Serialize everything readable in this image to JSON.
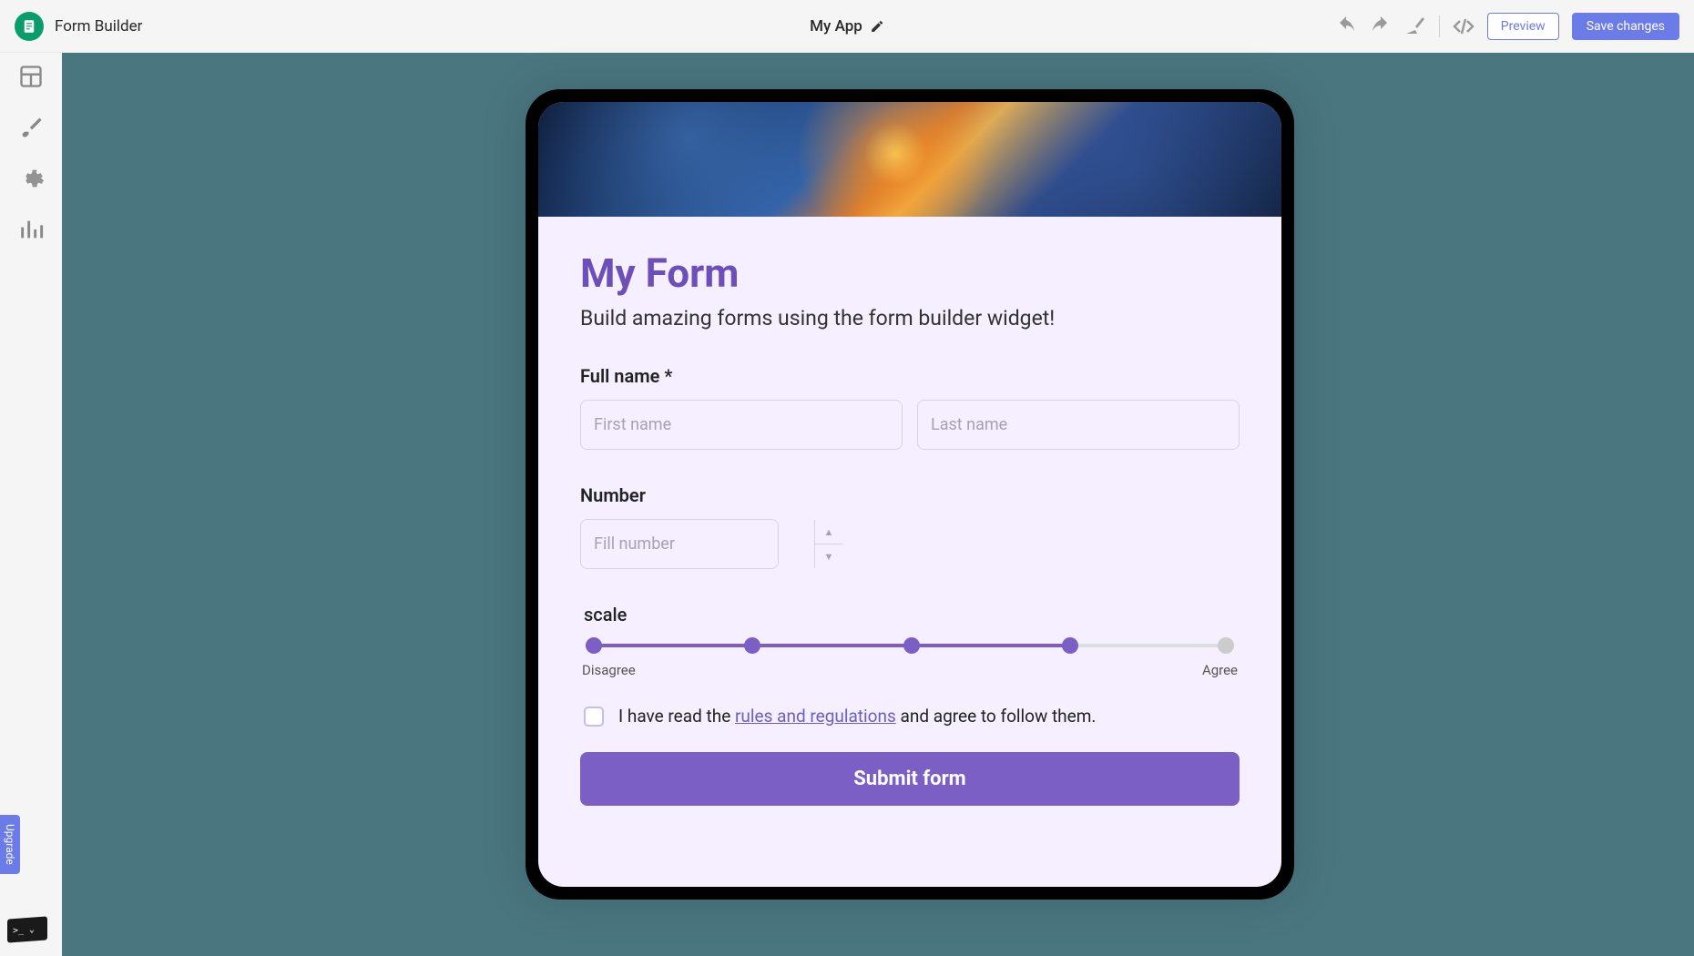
{
  "header": {
    "appName": "Form Builder",
    "projectTitle": "My App",
    "preview": "Preview",
    "save": "Save changes"
  },
  "sidebar": {
    "upgrade": "Upgrade"
  },
  "form": {
    "title": "My Form",
    "description": "Build amazing forms using the form builder widget!",
    "fullNameLabel": "Full name *",
    "firstNamePlaceholder": "First name",
    "lastNamePlaceholder": "Last name",
    "numberLabel": "Number",
    "numberPlaceholder": "Fill number",
    "scaleLabel": "scale",
    "scaleLeft": "Disagree",
    "scaleRight": "Agree",
    "consent": {
      "p1": "I have read the ",
      "link": "rules and regulations",
      "p2": " and agree to follow them."
    },
    "submit": "Submit form"
  }
}
